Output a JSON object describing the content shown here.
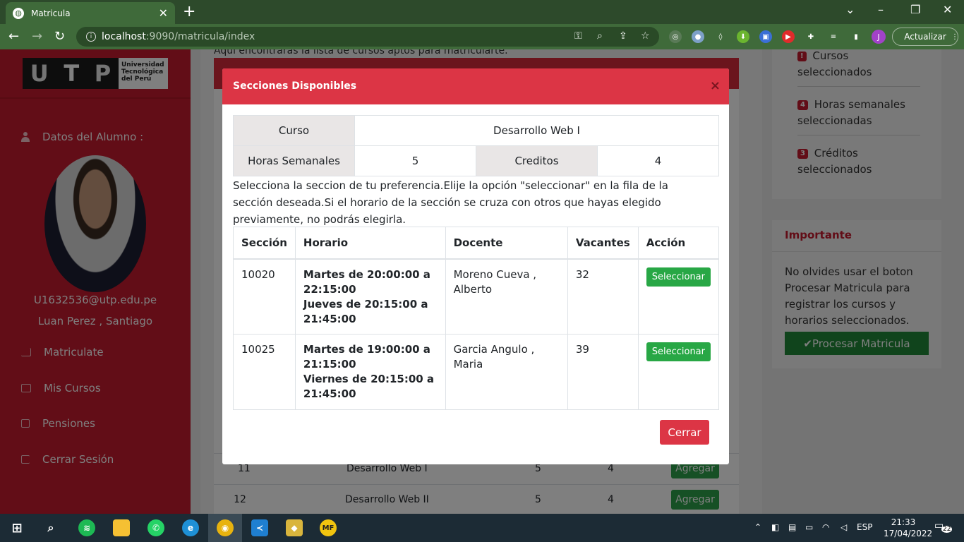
{
  "browser": {
    "tab_title": "Matricula",
    "url_host": "localhost",
    "url_rest": ":9090/matricula/index",
    "update_label": "Actualizar",
    "profile_initial": "J"
  },
  "sidebar": {
    "logo_letters": [
      "U",
      "T",
      "P"
    ],
    "logo_name": [
      "Universidad",
      "Tecnológica",
      "del Perú"
    ],
    "section_title": "Datos del Alumno :",
    "email": "U1632536@utp.edu.pe",
    "name": "Luan Perez , Santiago",
    "menu": [
      {
        "label": "Matriculate",
        "icon": "bar-chart-icon"
      },
      {
        "label": "Mis Cursos",
        "icon": "table-icon"
      },
      {
        "label": "Pensiones",
        "icon": "checkbox-icon"
      },
      {
        "label": "Cerrar Sesión",
        "icon": "sign-out-icon"
      }
    ]
  },
  "main": {
    "header_note": "Aquí encontrarás la lista de cursos aptos para matricularte.",
    "rows": [
      {
        "num": "11",
        "course": "Desarrollo Web I",
        "hours": "5",
        "credits": "4",
        "action": "Agregar"
      },
      {
        "num": "12",
        "course": "Desarrollo Web II",
        "hours": "5",
        "credits": "4",
        "action": "Agregar"
      }
    ]
  },
  "right": {
    "stats": [
      {
        "badge": "!",
        "label": "Cursos seleccionados"
      },
      {
        "badge": "4",
        "label": "Horas semanales seleccionadas"
      },
      {
        "badge": "3",
        "label": "Créditos seleccionados"
      }
    ],
    "important_title": "Importante",
    "important_text": "No olvides usar el boton Procesar Matricula para registrar los cursos y horarios seleccionados.",
    "process_label": "✔Procesar Matricula"
  },
  "modal": {
    "title": "Secciones Disponibles",
    "close_glyph": "×",
    "course_label": "Curso",
    "course_value": "Desarrollo Web I",
    "hours_label": "Horas Semanales",
    "hours_value": "5",
    "credits_label": "Creditos",
    "credits_value": "4",
    "instructions": "Selecciona la seccion de tu preferencia.Elije la opción \"seleccionar\" en la fila de la sección deseada.Si el horario de la sección se cruza con otros que hayas elegido previamente, no podrás elegirla.",
    "columns": [
      "Sección",
      "Horario",
      "Docente",
      "Vacantes",
      "Acción"
    ],
    "sections": [
      {
        "section": "10020",
        "schedule": [
          "Martes de 20:00:00 a 22:15:00",
          "Jueves de 20:15:00 a 21:45:00"
        ],
        "teacher": "Moreno Cueva , Alberto",
        "vacancies": "32",
        "action": "Seleccionar"
      },
      {
        "section": "10025",
        "schedule": [
          "Martes de 19:00:00 a 21:15:00",
          "Viernes de 20:15:00 a 21:45:00"
        ],
        "teacher": "Garcia Angulo , Maria",
        "vacancies": "39",
        "action": "Seleccionar"
      }
    ],
    "close_label": "Cerrar"
  },
  "taskbar": {
    "lang": "ESP",
    "time": "21:33",
    "date": "17/04/2022",
    "notifications": "22"
  },
  "colors": {
    "brand_red": "#dc3545",
    "sidebar_red": "#c41a2e",
    "success_green": "#28a745",
    "chrome_green": "#3f6a3a"
  }
}
